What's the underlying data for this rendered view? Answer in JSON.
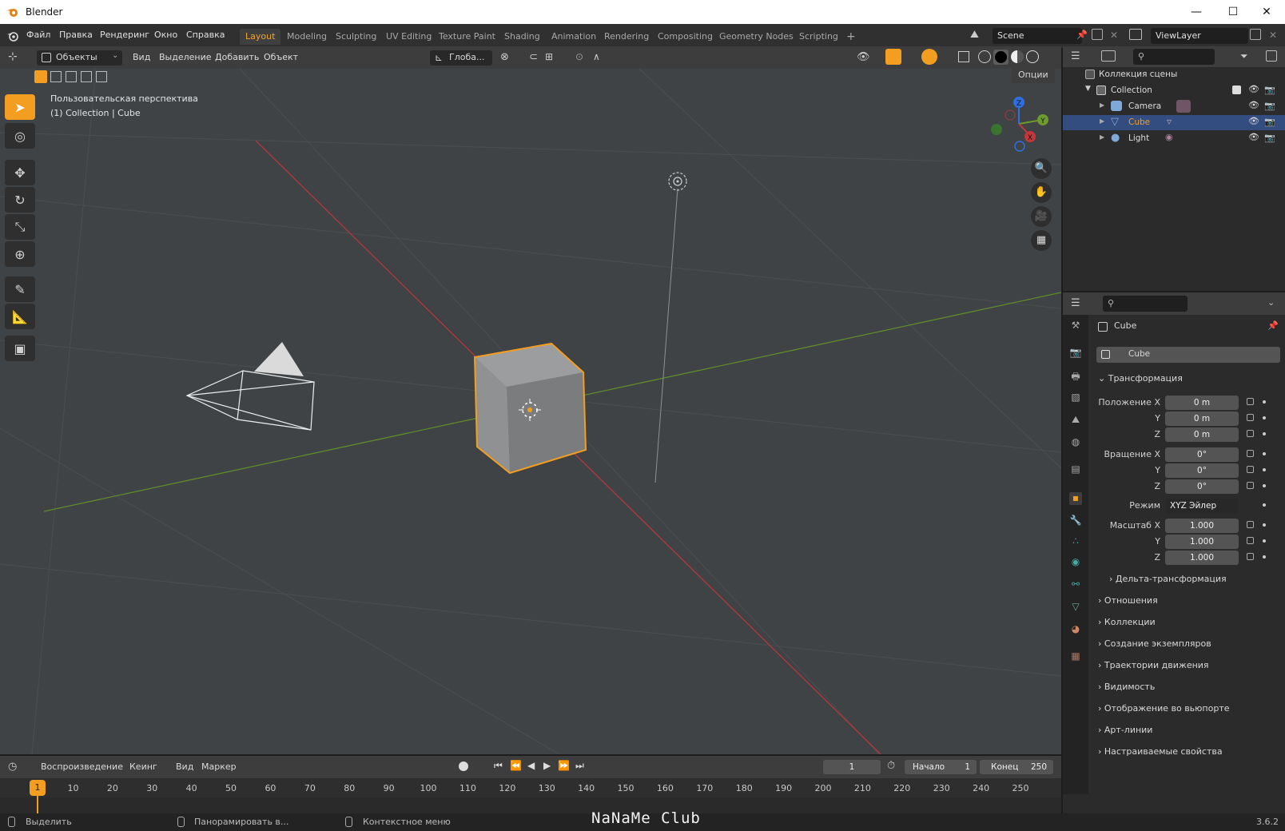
{
  "window": {
    "title": "Blender",
    "minimize": "—",
    "maximize": "☐",
    "close": "✕"
  },
  "menu": [
    "Файл",
    "Правка",
    "Рендеринг",
    "Окно",
    "Справка"
  ],
  "workspaces": [
    "Layout",
    "Modeling",
    "Sculpting",
    "UV Editing",
    "Texture Paint",
    "Shading",
    "Animation",
    "Rendering",
    "Compositing",
    "Geometry Nodes",
    "Scripting"
  ],
  "add_tab": "+",
  "scene": {
    "name": "Scene",
    "view_layer": "ViewLayer"
  },
  "viewport_header": {
    "mode": "Объекты",
    "menus": [
      "Вид",
      "Выделение",
      "Добавить",
      "Объект"
    ],
    "orientation": "Глоба...",
    "options": "Опции"
  },
  "viewport": {
    "perspective": "Пользовательская перспектива",
    "context": "(1) Collection | Cube"
  },
  "gizmo": {
    "x": "X",
    "y": "Y",
    "z": "Z"
  },
  "outliner": {
    "root": "Коллекция сцены",
    "collection": "Collection",
    "items": [
      "Camera",
      "Cube",
      "Light"
    ]
  },
  "properties": {
    "object_name": "Cube",
    "data_name": "Cube",
    "transform_title": "Трансформация",
    "location_label": "Положение X",
    "location": [
      "0 m",
      "0 m",
      "0 m"
    ],
    "rotation_label": "Вращение X",
    "rotation": [
      "0°",
      "0°",
      "0°"
    ],
    "mode_label": "Режим",
    "mode_value": "XYZ Эйлер",
    "scale_label": "Масштаб X",
    "scale": [
      "1.000",
      "1.000",
      "1.000"
    ],
    "axis_y": "Y",
    "axis_z": "Z",
    "delta": "Дельта-трансформация",
    "sections": [
      "Отношения",
      "Коллекции",
      "Создание экземпляров",
      "Траектории движения",
      "Видимость",
      "Отображение во вьюпорте",
      "Арт-линии",
      "Настраиваемые свойства"
    ]
  },
  "timeline_header": {
    "menus": [
      "Воспроизведение",
      "Кеинг",
      "Вид",
      "Маркер"
    ],
    "current_frame": "1",
    "start_label": "Начало",
    "start": "1",
    "end_label": "Конец",
    "end": "250"
  },
  "timeline_ticks": [
    "10",
    "20",
    "30",
    "40",
    "50",
    "60",
    "70",
    "80",
    "90",
    "100",
    "110",
    "120",
    "130",
    "140",
    "150",
    "160",
    "170",
    "180",
    "190",
    "200",
    "210",
    "220",
    "230",
    "240",
    "250"
  ],
  "timeline_current": "1",
  "status": {
    "select": "Выделить",
    "pan": "Панорамировать в...",
    "context_menu": "Контекстное меню",
    "watermark": "NaNaMe Club",
    "version": "3.6.2"
  },
  "colors": {
    "accent": "#f39d21",
    "selection": "#f39d21",
    "x_axis": "#c4373d",
    "y_axis": "#6d9b2d",
    "z_axis": "#2f6ee0"
  }
}
